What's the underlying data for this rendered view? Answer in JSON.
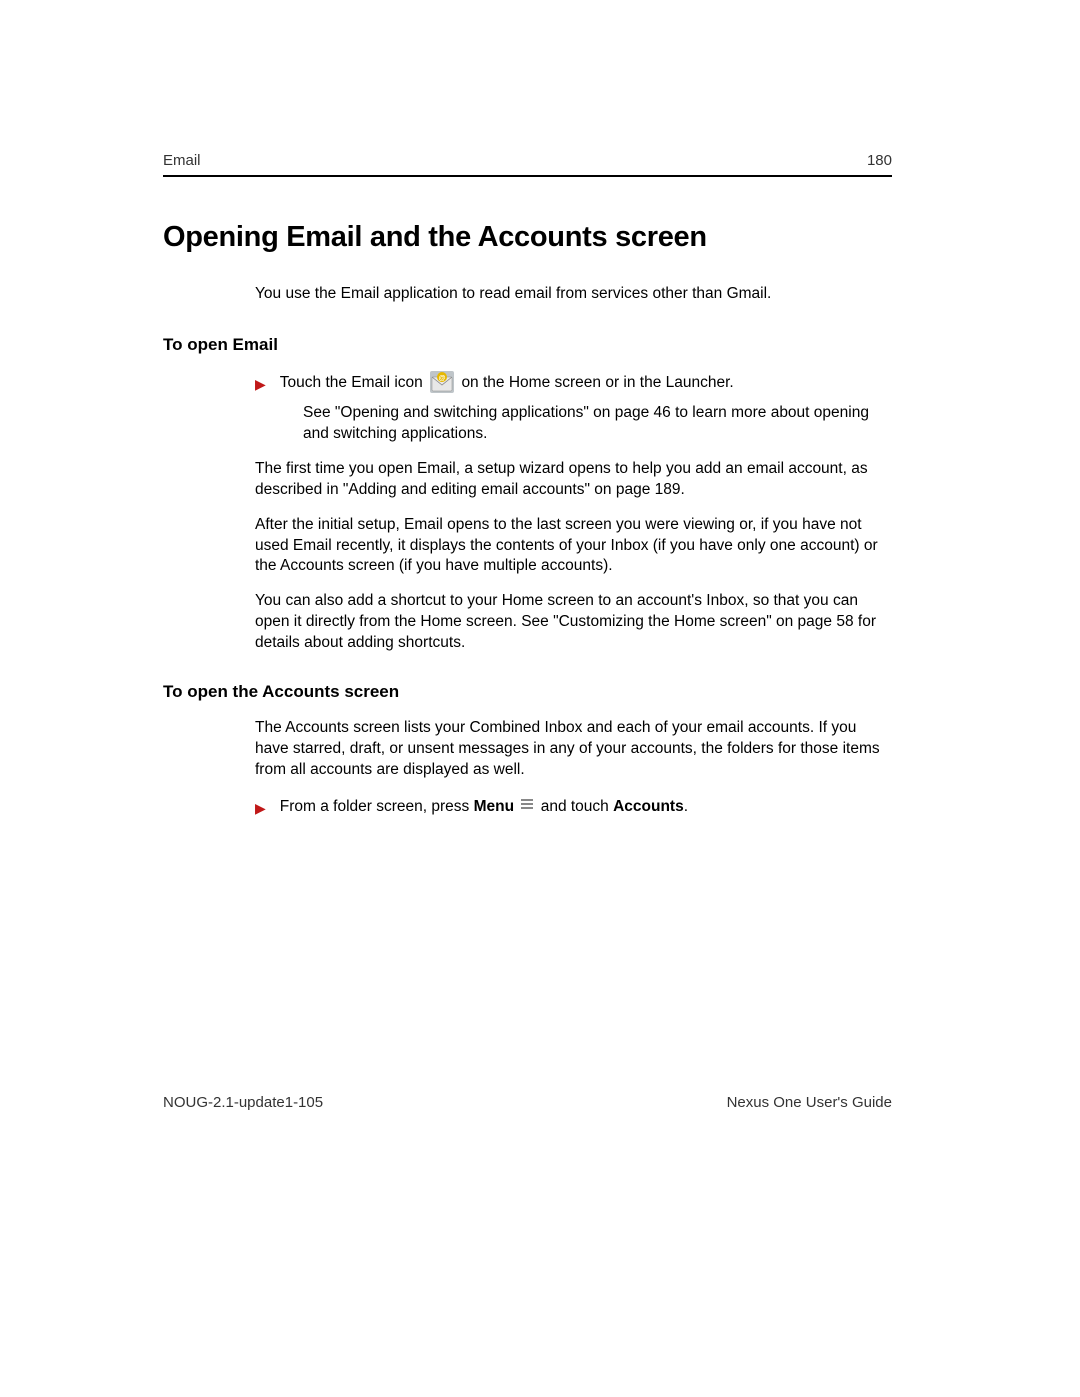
{
  "header": {
    "section": "Email",
    "page_number": "180"
  },
  "title": "Opening Email and the Accounts screen",
  "intro": "You use the Email application to read email from services other than Gmail.",
  "section1": {
    "heading": "To open Email",
    "bullet1_a": "Touch the Email icon",
    "bullet1_b": "on the Home screen or in the Launcher.",
    "bullet1_follow": "See \"Opening and switching applications\" on page 46 to learn more about opening and switching applications.",
    "para1": "The first time you open Email, a setup wizard opens to help you add an email account, as described in \"Adding and editing email accounts\" on page 189.",
    "para2": "After the initial setup, Email opens to the last screen you were viewing or, if you have not used Email recently, it displays the contents of your Inbox (if you have only one account) or the Accounts screen (if you have multiple accounts).",
    "para3": "You can also add a shortcut to your Home screen to an account's Inbox, so that you can open it directly from the Home screen. See \"Customizing the Home screen\" on page 58 for details about adding shortcuts."
  },
  "section2": {
    "heading": "To open the Accounts screen",
    "para1": "The Accounts screen lists your Combined Inbox and each of your email accounts. If you have starred, draft, or unsent messages in any of your accounts, the folders for those items from all accounts are displayed as well.",
    "bullet_a": "From a folder screen, press ",
    "bullet_menu": "Menu",
    "bullet_b": " and touch ",
    "bullet_accounts": "Accounts",
    "bullet_c": "."
  },
  "footer": {
    "left": "NOUG-2.1-update1-105",
    "right": "Nexus One User's Guide"
  }
}
